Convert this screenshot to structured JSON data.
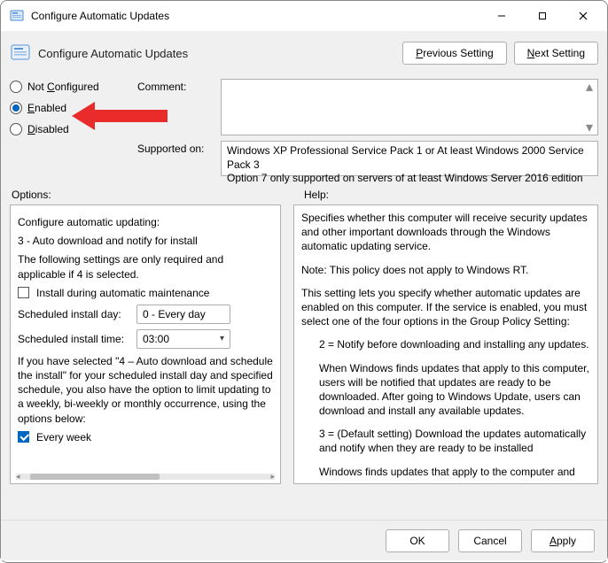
{
  "window": {
    "title": "Configure Automatic Updates"
  },
  "header": {
    "subtitle": "Configure Automatic Updates",
    "prev": "Previous Setting",
    "next": "Next Setting"
  },
  "radios": {
    "not_configured": "Not Configured",
    "enabled": "Enabled",
    "disabled": "Disabled",
    "selected": "enabled"
  },
  "fields": {
    "comment_label": "Comment:",
    "supported_label": "Supported on:",
    "supported_text": "Windows XP Professional Service Pack 1 or At least Windows 2000 Service Pack 3\nOption 7 only supported on servers of at least Windows Server 2016 edition"
  },
  "section_labels": {
    "options": "Options:",
    "help": "Help:"
  },
  "options": {
    "configure_label": "Configure automatic updating:",
    "configure_value": "3 - Auto download and notify for install",
    "following_text": "The following settings are only required and applicable if 4 is selected.",
    "install_maint": "Install during automatic maintenance",
    "install_maint_checked": false,
    "day_label": "Scheduled install day:",
    "day_value": "0 - Every day",
    "time_label": "Scheduled install time:",
    "time_value": "03:00",
    "selected4_text": "If you have selected \"4 – Auto download and schedule the install\" for your scheduled install day and specified schedule, you also have the option to limit updating to a weekly, bi-weekly or monthly occurrence, using the options below:",
    "every_week": "Every week",
    "every_week_checked": true
  },
  "help": {
    "p1": "Specifies whether this computer will receive security updates and other important downloads through the Windows automatic updating service.",
    "p2": "Note: This policy does not apply to Windows RT.",
    "p3": "This setting lets you specify whether automatic updates are enabled on this computer. If the service is enabled, you must select one of the four options in the Group Policy Setting:",
    "p4": "2 = Notify before downloading and installing any updates.",
    "p5": "When Windows finds updates that apply to this computer, users will be notified that updates are ready to be downloaded. After going to Windows Update, users can download and install any available updates.",
    "p6": "3 = (Default setting) Download the updates automatically and notify when they are ready to be installed",
    "p7": "Windows finds updates that apply to the computer and"
  },
  "footer": {
    "ok": "OK",
    "cancel": "Cancel",
    "apply": "Apply"
  }
}
